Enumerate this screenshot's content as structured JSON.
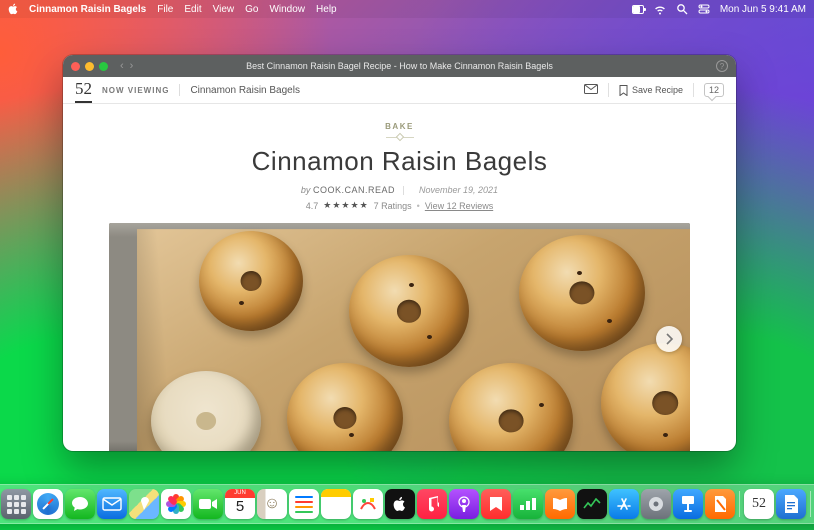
{
  "menubar": {
    "app_name": "Cinnamon Raisin Bagels",
    "menus": [
      "File",
      "Edit",
      "View",
      "Go",
      "Window",
      "Help"
    ],
    "clock": "Mon Jun 5 9:41 AM"
  },
  "window": {
    "title": "Best Cinnamon Raisin Bagel Recipe - How to Make Cinnamon Raisin Bagels",
    "logo": "52",
    "now_viewing_label": "NOW VIEWING",
    "breadcrumb": "Cinnamon Raisin Bagels",
    "save_label": "Save Recipe",
    "comment_count": "12"
  },
  "article": {
    "category": "BAKE",
    "title": "Cinnamon Raisin Bagels",
    "by_label": "by",
    "author": "COOK.CAN.READ",
    "date": "November 19, 2021",
    "rating_value": "4.7",
    "stars_glyph": "★★★★★",
    "ratings_count_label": "7 Ratings",
    "reviews_link_label": "View 12 Reviews"
  },
  "calendar": {
    "month": "JUN",
    "day": "5"
  },
  "dock_app_label": "52"
}
